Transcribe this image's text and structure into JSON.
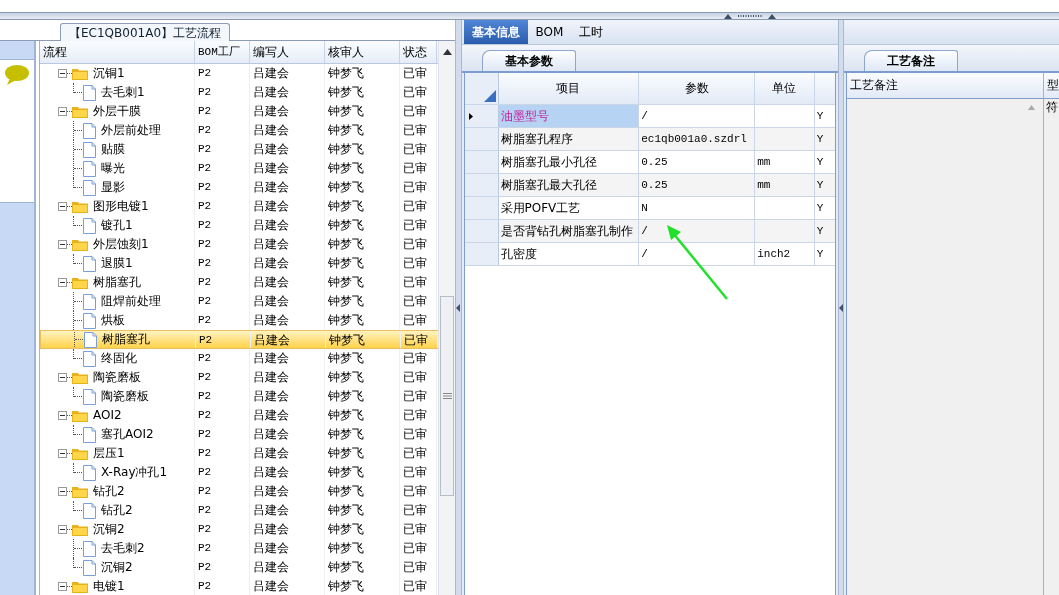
{
  "title_tab": "【EC1QB001A0】工艺流程",
  "tree": {
    "columns": [
      "流程",
      "BOM工厂",
      "编写人",
      "核审人",
      "状态"
    ],
    "rows": [
      {
        "name": "沉铜1",
        "bom": "P2",
        "author": "吕建会",
        "reviewer": "钟梦飞",
        "status": "已审",
        "selected": false,
        "expanded": true,
        "children": [
          {
            "name": "去毛刺1",
            "bom": "P2",
            "author": "吕建会",
            "reviewer": "钟梦飞",
            "status": "已审",
            "selected": false
          }
        ]
      },
      {
        "name": "外层干膜",
        "bom": "P2",
        "author": "吕建会",
        "reviewer": "钟梦飞",
        "status": "已审",
        "selected": false,
        "expanded": true,
        "children": [
          {
            "name": "外层前处理",
            "bom": "P2",
            "author": "吕建会",
            "reviewer": "钟梦飞",
            "status": "已审",
            "selected": false
          },
          {
            "name": "贴膜",
            "bom": "P2",
            "author": "吕建会",
            "reviewer": "钟梦飞",
            "status": "已审",
            "selected": false
          },
          {
            "name": "曝光",
            "bom": "P2",
            "author": "吕建会",
            "reviewer": "钟梦飞",
            "status": "已审",
            "selected": false
          },
          {
            "name": "显影",
            "bom": "P2",
            "author": "吕建会",
            "reviewer": "钟梦飞",
            "status": "已审",
            "selected": false
          }
        ]
      },
      {
        "name": "图形电镀1",
        "bom": "P2",
        "author": "吕建会",
        "reviewer": "钟梦飞",
        "status": "已审",
        "selected": false,
        "expanded": true,
        "children": [
          {
            "name": "镀孔1",
            "bom": "P2",
            "author": "吕建会",
            "reviewer": "钟梦飞",
            "status": "已审",
            "selected": false
          }
        ]
      },
      {
        "name": "外层蚀刻1",
        "bom": "P2",
        "author": "吕建会",
        "reviewer": "钟梦飞",
        "status": "已审",
        "selected": false,
        "expanded": true,
        "children": [
          {
            "name": "退膜1",
            "bom": "P2",
            "author": "吕建会",
            "reviewer": "钟梦飞",
            "status": "已审",
            "selected": false
          }
        ]
      },
      {
        "name": "树脂塞孔",
        "bom": "P2",
        "author": "吕建会",
        "reviewer": "钟梦飞",
        "status": "已审",
        "selected": false,
        "expanded": true,
        "children": [
          {
            "name": "阻焊前处理",
            "bom": "P2",
            "author": "吕建会",
            "reviewer": "钟梦飞",
            "status": "已审",
            "selected": false
          },
          {
            "name": "烘板",
            "bom": "P2",
            "author": "吕建会",
            "reviewer": "钟梦飞",
            "status": "已审",
            "selected": false
          },
          {
            "name": "树脂塞孔",
            "bom": "P2",
            "author": "吕建会",
            "reviewer": "钟梦飞",
            "status": "已审",
            "selected": true
          },
          {
            "name": "终固化",
            "bom": "P2",
            "author": "吕建会",
            "reviewer": "钟梦飞",
            "status": "已审",
            "selected": false
          }
        ]
      },
      {
        "name": "陶瓷磨板",
        "bom": "P2",
        "author": "吕建会",
        "reviewer": "钟梦飞",
        "status": "已审",
        "selected": false,
        "expanded": true,
        "children": [
          {
            "name": "陶瓷磨板",
            "bom": "P2",
            "author": "吕建会",
            "reviewer": "钟梦飞",
            "status": "已审",
            "selected": false
          }
        ]
      },
      {
        "name": "AOI2",
        "bom": "P2",
        "author": "吕建会",
        "reviewer": "钟梦飞",
        "status": "已审",
        "selected": false,
        "expanded": true,
        "children": [
          {
            "name": "塞孔AOI2",
            "bom": "P2",
            "author": "吕建会",
            "reviewer": "钟梦飞",
            "status": "已审",
            "selected": false
          }
        ]
      },
      {
        "name": "层压1",
        "bom": "P2",
        "author": "吕建会",
        "reviewer": "钟梦飞",
        "status": "已审",
        "selected": false,
        "expanded": true,
        "children": [
          {
            "name": "X-Ray冲孔1",
            "bom": "P2",
            "author": "吕建会",
            "reviewer": "钟梦飞",
            "status": "已审",
            "selected": false
          }
        ]
      },
      {
        "name": "钻孔2",
        "bom": "P2",
        "author": "吕建会",
        "reviewer": "钟梦飞",
        "status": "已审",
        "selected": false,
        "expanded": true,
        "children": [
          {
            "name": "钻孔2",
            "bom": "P2",
            "author": "吕建会",
            "reviewer": "钟梦飞",
            "status": "已审",
            "selected": false
          }
        ]
      },
      {
        "name": "沉铜2",
        "bom": "P2",
        "author": "吕建会",
        "reviewer": "钟梦飞",
        "status": "已审",
        "selected": false,
        "expanded": true,
        "children": [
          {
            "name": "去毛刺2",
            "bom": "P2",
            "author": "吕建会",
            "reviewer": "钟梦飞",
            "status": "已审",
            "selected": false
          },
          {
            "name": "沉铜2",
            "bom": "P2",
            "author": "吕建会",
            "reviewer": "钟梦飞",
            "status": "已审",
            "selected": false
          }
        ]
      },
      {
        "name": "电镀1",
        "bom": "P2",
        "author": "吕建会",
        "reviewer": "钟梦飞",
        "status": "已审",
        "selected": false,
        "expanded": true
      }
    ]
  },
  "tabs": [
    {
      "label": "基本信息",
      "selected": true
    },
    {
      "label": "BOM",
      "selected": false
    },
    {
      "label": "工时",
      "selected": false
    }
  ],
  "subtab": "基本参数",
  "grid": {
    "columns": [
      "项目",
      "参数",
      "单位"
    ],
    "rows": [
      {
        "item": "油墨型号",
        "param": "/",
        "column_4": "Y",
        "selected": true
      },
      {
        "item": "树脂塞孔程序",
        "param": "ec1qb001a0.szdrl",
        "column_4": "Y",
        "selected": false
      },
      {
        "item": "树脂塞孔最小孔径",
        "param": "0.25",
        "unit": "mm",
        "column_4": "Y",
        "selected": false
      },
      {
        "item": "树脂塞孔最大孔径",
        "param": "0.25",
        "unit": "mm",
        "column_4": "Y",
        "selected": false
      },
      {
        "item": "采用POFV工艺",
        "param": "N",
        "column_4": "Y",
        "selected": false
      },
      {
        "item": "是否背钻孔树脂塞孔制作",
        "param": "/",
        "column_4": "Y",
        "selected": false
      },
      {
        "item": "孔密度",
        "param": "/",
        "unit": "inch2",
        "column_4": "Y",
        "selected": false
      }
    ]
  },
  "remarks": {
    "tab": "工艺备注",
    "columns": [
      "工艺备注",
      "型"
    ],
    "cell": "符"
  }
}
